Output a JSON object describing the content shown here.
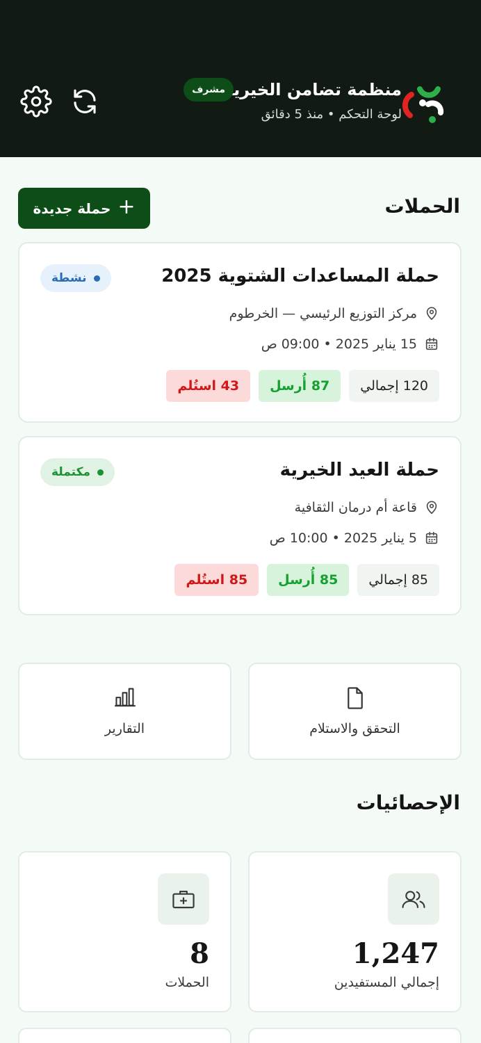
{
  "header": {
    "org_name": "منظمة تضامن الخيرية",
    "role_badge": "مشرف",
    "subtitle": "لوحة التحكم • منذ 5 دقائق",
    "logo_icon": "org-logo",
    "refresh_icon": "refresh-icon",
    "settings_icon": "gear-icon"
  },
  "campaigns_section": {
    "title": "الحملات",
    "new_button_label": "حملة جديدة",
    "new_button_icon": "plus-icon"
  },
  "campaigns": [
    {
      "title": "حملة المساعدات الشتوية 2025",
      "status": "نشطة",
      "status_color": "#2a6db5",
      "location": "مركز التوزيع الرئيسي — الخرطوم",
      "datetime": "15 يناير 2025 • 09:00 ص",
      "total_label": "120 إجمالي",
      "sent_label": "87 أُرسل",
      "received_label": "43 استُلم"
    },
    {
      "title": "حملة العيد الخيرية",
      "status": "مكتملة",
      "status_color": "#1a9132",
      "location": "قاعة أم درمان الثقافية",
      "datetime": "5 يناير 2025 • 10:00 ص",
      "total_label": "85 إجمالي",
      "sent_label": "85 أُرسل",
      "received_label": "85 استُلم"
    }
  ],
  "quick_actions": [
    {
      "label": "التحقق والاستلام",
      "icon": "document-icon"
    },
    {
      "label": "التقارير",
      "icon": "bar-chart-icon"
    }
  ],
  "stats_section": {
    "title": "الإحصائيات",
    "items": [
      {
        "value": "1,247",
        "label": "إجمالي المستفيدين",
        "icon": "users-icon"
      },
      {
        "value": "8",
        "label": "الحملات",
        "icon": "first-aid-kit-icon"
      }
    ]
  },
  "colors": {
    "brand_dark": "#121a14",
    "primary_green": "#0d4d17",
    "sent_green": "#15a030",
    "received_red": "#d11818",
    "active_blue": "#2a6db5"
  }
}
